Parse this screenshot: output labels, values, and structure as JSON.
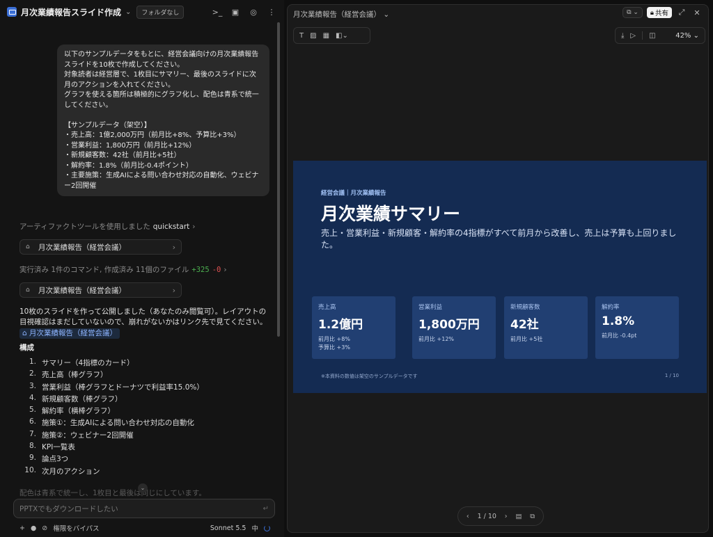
{
  "chat": {
    "title": "月次業績報告スライド作成",
    "folder_badge": "フォルダなし",
    "user_message": "以下のサンプルデータをもとに、経営会議向けの月次業績報告\nスライドを10枚で作成してください。\n対象読者は経営層で、1枚目にサマリー、最後のスライドに次\n月のアクションを入れてください。\nグラフを使える箇所は積極的にグラフ化し、配色は青系で統一\nしてください。\n\n【サンプルデータ（架空）】\n・売上高：1億2,000万円（前月比+8%、予算比+3%）\n・営業利益：1,800万円（前月比+12%）\n・新規顧客数：42社（前月比+5社）\n・解約率：1.8%（前月比-0.4ポイント）\n・主要施策：生成AIによる問い合わせ対応の自動化、ウェビナ\nー2回開催",
    "tool_use_prefix": "アーティファクトツールを使用しました",
    "tool_use_name": "quickstart",
    "artifact_1": "月次業績報告（経営会議）",
    "exec_prefix": "実行済み 1件のコマンド, 作成済み 11個のファイル",
    "exec_plus": "+325",
    "exec_minus": "-0",
    "artifact_2": "月次業績報告（経営会議）",
    "response_text": "10枚のスライドを作って公開しました（あなたのみ閲覧可）。レイアウトの目視確認はまだしていないので、崩れがないかはリンク先で見てください。",
    "response_link": "月次業績報告（経営会議）",
    "structure_heading": "構成",
    "structure_items": [
      {
        "num": "1.",
        "text": "サマリー（4指標のカード）"
      },
      {
        "num": "2.",
        "text": "売上高（棒グラフ）"
      },
      {
        "num": "3.",
        "text": "営業利益（棒グラフとドーナツで利益率15.0%）"
      },
      {
        "num": "4.",
        "text": "新規顧客数（棒グラフ）"
      },
      {
        "num": "5.",
        "text": "解約率（横棒グラフ）"
      },
      {
        "num": "6.",
        "text": "施策①：生成AIによる問い合わせ対応の自動化"
      },
      {
        "num": "7.",
        "text": "施策②：ウェビナー2回開催"
      },
      {
        "num": "8.",
        "text": "KPI一覧表"
      },
      {
        "num": "9.",
        "text": "論点3つ"
      },
      {
        "num": "10.",
        "text": "次月のアクション"
      }
    ],
    "faded_text": "配色は青系で統一し、1枚目と最後は同じにしています。",
    "input_value": "PPTXでもダウンロードしたい",
    "permission_label": "権限をバイパス",
    "model_name": "Sonnet 5.5",
    "effort_label": "中"
  },
  "preview": {
    "title": "月次業績報告（経営会議）",
    "share_label": "共有",
    "zoom": "42%",
    "pager": "1 / 10"
  },
  "slide": {
    "eyebrow": "経営会議｜月次業績報告",
    "title": "月次業績サマリー",
    "subtitle": "売上・営業利益・新規顧客・解約率の4指標がすべて前月から改善し、売上は予算も上回りました。",
    "cards": [
      {
        "label": "売上高",
        "value": "1.2億円",
        "sub1": "前月比 +8%",
        "sub2": "予算比 +3%"
      },
      {
        "label": "営業利益",
        "value": "1,800万円",
        "sub1": "前月比 +12%",
        "sub2": ""
      },
      {
        "label": "新規顧客数",
        "value": "42社",
        "sub1": "前月比 +5社",
        "sub2": ""
      },
      {
        "label": "解約率",
        "value": "1.8%",
        "sub1": "前月比 -0.4pt",
        "sub2": ""
      }
    ],
    "footnote": "※本資料の数値は架空のサンプルデータです",
    "page": "1 / 10"
  },
  "colors": {
    "slide_bg": "#142b52",
    "card_bg": "#213f72",
    "accent": "#3b6fd6"
  }
}
